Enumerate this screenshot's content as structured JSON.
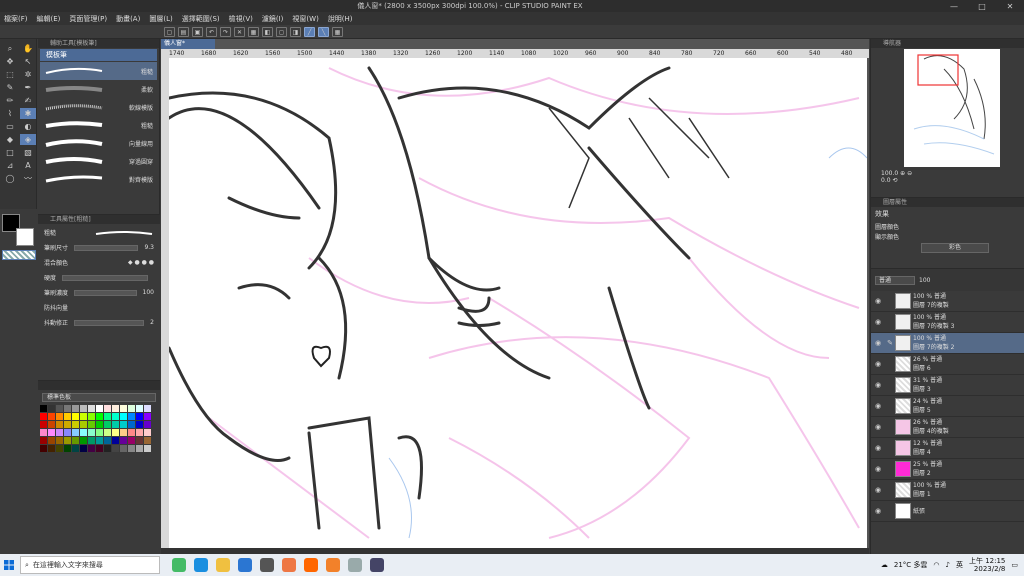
{
  "window": {
    "title": "儀人窗* (2800 x 3500px 300dpi 100.0%) - CLIP STUDIO PAINT EX",
    "controls": [
      "—",
      "□",
      "✕"
    ]
  },
  "menu": [
    "檔案(F)",
    "編輯(E)",
    "頁面管理(P)",
    "動畫(A)",
    "圖層(L)",
    "選擇範圍(S)",
    "檢視(V)",
    "濾鏡(I)",
    "視窗(W)",
    "說明(H)"
  ],
  "subtool": {
    "panel_title": "輔助工具[模板筆]",
    "group": "模板筆",
    "brushes": [
      "粗糙",
      "柔軟",
      "軟線模版",
      "粗糙",
      "向量線用",
      "穿過圓穿",
      "對齊模版"
    ]
  },
  "tool_property": {
    "panel_title": "工具屬性[粗糙]",
    "name": "粗糙",
    "brush_size_label": "筆刷尺寸",
    "brush_size_value": "9.3",
    "blend_label": "混合顏色",
    "hardness_label": "硬度",
    "density_label": "筆刷濃度",
    "density_value": "100",
    "anti_overflow_label": "防抖向量",
    "stabilization_label": "抖動修正",
    "stabilization_value": "2"
  },
  "color_set": {
    "selector": "標準色板"
  },
  "canvas": {
    "tab": "儀人窗*",
    "ruler_ticks": [
      "1740",
      "1680",
      "1620",
      "1560",
      "1500",
      "1440",
      "1380",
      "1320",
      "1260",
      "1200",
      "1140",
      "1080",
      "1020",
      "960",
      "900",
      "840",
      "780",
      "720",
      "660",
      "600",
      "540",
      "480"
    ]
  },
  "navigator": {
    "title": "導航器",
    "zoom": "100.0",
    "angle": "0.0"
  },
  "effect": {
    "panel_title": "圖層屬性",
    "title": "效果",
    "layer_color": "圖層顏色",
    "display_color_label": "顯示顏色",
    "display_color": "彩色"
  },
  "layers": {
    "mode": "普通",
    "opacity": "100",
    "items": [
      {
        "pct": "100 % 普通",
        "name": "圖層 7的複製",
        "thumb": "folder",
        "sel": false
      },
      {
        "pct": "100 % 普通",
        "name": "圖層 7的複製 3",
        "thumb": "folder",
        "sel": false
      },
      {
        "pct": "100 % 普通",
        "name": "圖層 7的複製 2",
        "thumb": "folder",
        "sel": true
      },
      {
        "pct": "26 % 普通",
        "name": "圖層 6",
        "thumb": "plain",
        "sel": false
      },
      {
        "pct": "31 % 普通",
        "name": "圖層 3",
        "thumb": "plain",
        "sel": false
      },
      {
        "pct": "24 % 普通",
        "name": "圖層 5",
        "thumb": "plain",
        "sel": false
      },
      {
        "pct": "26 % 普通",
        "name": "圖層 4的複製",
        "thumb": "pink",
        "sel": false
      },
      {
        "pct": "12 % 普通",
        "name": "圖層 4",
        "thumb": "pink",
        "sel": false
      },
      {
        "pct": "25 % 普通",
        "name": "圖層 2",
        "thumb": "mag",
        "sel": false
      },
      {
        "pct": "100 % 普通",
        "name": "圖層 1",
        "thumb": "plain",
        "sel": false
      },
      {
        "pct": "",
        "name": "紙張",
        "thumb": "white",
        "sel": false
      }
    ]
  },
  "taskbar": {
    "search_placeholder": "在這裡輸入文字來搜尋",
    "weather": "21°C 多雲",
    "ime": "英",
    "time": "上午 12:15",
    "date": "2023/2/8"
  }
}
